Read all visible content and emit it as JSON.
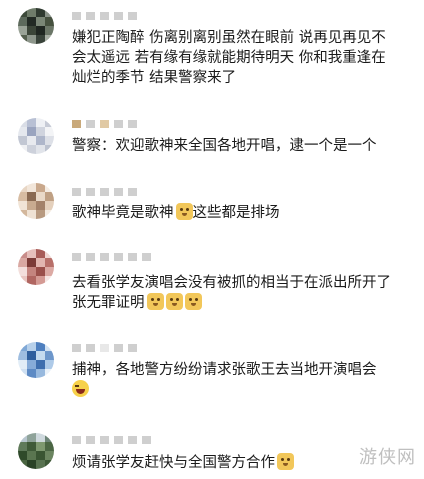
{
  "comments": [
    {
      "lines": [
        "嫌犯正陶醉 伤离别离别虽然在眼前 说再见再见不",
        "会太遥远 若有缘有缘就能期待明天 你和我重逢在",
        "灿烂的季节 结果警察来了"
      ]
    },
    {
      "lines": [
        "警察：欢迎歌神来全国各地开唱，逮一个是一个"
      ]
    },
    {
      "lines": [
        "歌神毕竟是歌神",
        "这些都是排场"
      ],
      "emoji": "doge-emoji"
    },
    {
      "lines": [
        "去看张学友演唱会没有被抓的相当于在派出所开了",
        "张无罪证明"
      ],
      "emoji": "doge-emoji"
    },
    {
      "lines": [
        "捕神，各地警方纷纷请求张歌王去当地开演唱会"
      ],
      "emoji": "laugh-emoji"
    },
    {
      "lines": [
        "烦请张学友赶快与全国警方合作"
      ],
      "emoji": "doge-emoji"
    }
  ],
  "watermark": "游侠网"
}
